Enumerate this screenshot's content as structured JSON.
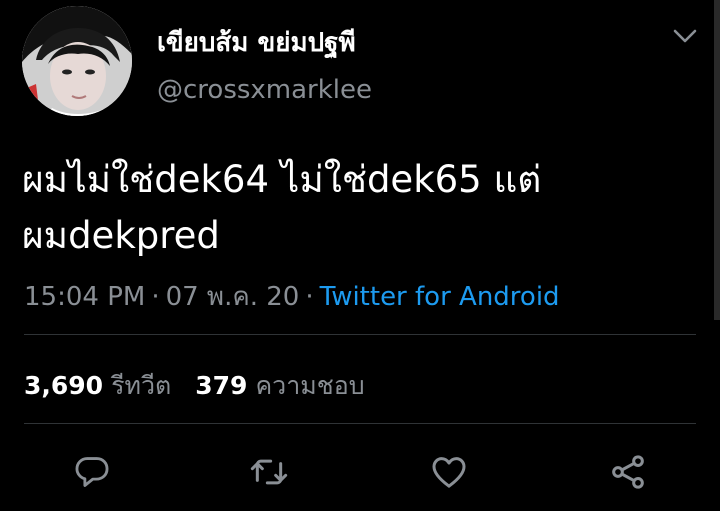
{
  "tweet": {
    "display_name": "เขียบส้ม ขย่มปฐพี",
    "handle": "@crossxmarklee",
    "text": "ผมไม่ใช่dek64 ไม่ใช่dek65 แต่ผมdekpred",
    "time": "15:04 PM",
    "date": "07 พ.ค. 20",
    "separator": "·",
    "source": "Twitter for Android"
  },
  "stats": {
    "retweets_count": "3,690",
    "retweets_label": "รีทวีต",
    "likes_count": "379",
    "likes_label": "ความชอบ"
  },
  "actions": {
    "icons": [
      "reply-icon",
      "retweet-icon",
      "like-icon",
      "share-icon"
    ]
  },
  "colors": {
    "background": "#000000",
    "text": "#ffffff",
    "secondary": "#8a8f95",
    "link": "#1d9bf0",
    "divider": "#2f3336"
  }
}
